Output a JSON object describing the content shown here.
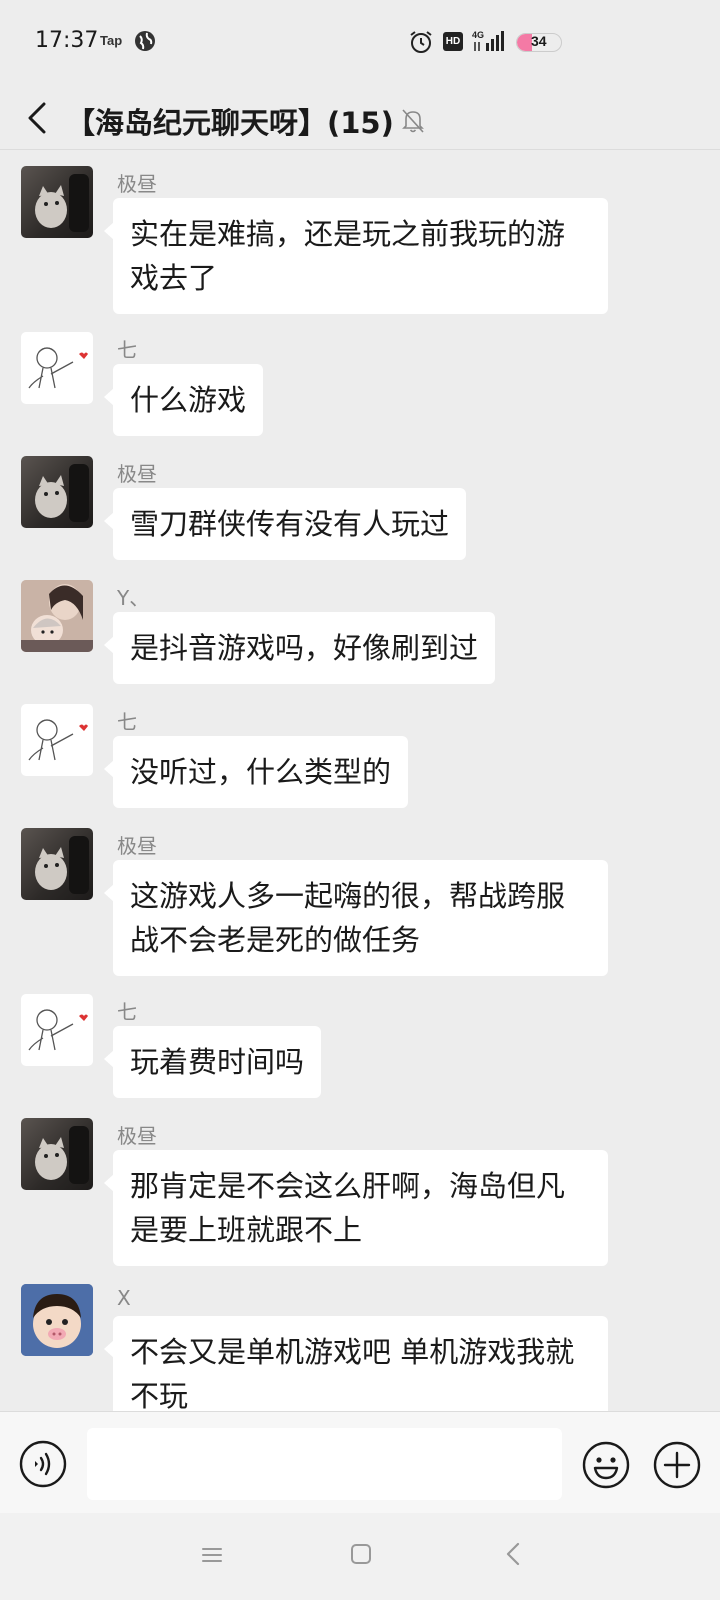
{
  "status_bar": {
    "time": "17:37",
    "tap_label": "Tap",
    "hd_label": "HD",
    "network": "4G",
    "battery_level": "34",
    "battery_fraction": 0.34,
    "battery_color": "#f47aa5"
  },
  "header": {
    "title": "【海岛纪元聊天呀】(15)",
    "back_icon": "back-arrow-icon",
    "mute_icon": "muted-bell-icon"
  },
  "messages": [
    {
      "sender": "极昼",
      "avatar": "cat-avatar",
      "text": "实在是难搞，还是玩之前我玩的游戏去了"
    },
    {
      "sender": "七",
      "avatar": "sketch-avatar",
      "text": "什么游戏"
    },
    {
      "sender": "极昼",
      "avatar": "cat-avatar",
      "text": "雪刀群侠传有没有人玩过"
    },
    {
      "sender": "Y、",
      "avatar": "photo-avatar",
      "text": "是抖音游戏吗，好像刷到过"
    },
    {
      "sender": "七",
      "avatar": "sketch-avatar",
      "text": "没听过，什么类型的"
    },
    {
      "sender": "极昼",
      "avatar": "cat-avatar",
      "text": "这游戏人多一起嗨的很，帮战跨服战不会老是死的做任务"
    },
    {
      "sender": "七",
      "avatar": "sketch-avatar",
      "text": "玩着费时间吗"
    },
    {
      "sender": "极昼",
      "avatar": "cat-avatar",
      "text": "那肯定是不会这么肝啊，海岛但凡是要上班就跟不上"
    },
    {
      "sender": "X",
      "avatar": "kid-avatar",
      "text": "不会又是单机游戏吧 单机游戏我就不玩"
    }
  ],
  "input_bar": {
    "voice_icon": "voice-icon",
    "input_value": "",
    "emoji_icon": "emoji-icon",
    "add_icon": "plus-icon"
  },
  "nav_bar": {
    "menu_icon": "menu-icon",
    "home_icon": "home-square-icon",
    "back_icon": "back-triangle-icon"
  },
  "colors": {
    "background": "#ededed",
    "bubble": "#ffffff",
    "sender_name": "#888888"
  }
}
